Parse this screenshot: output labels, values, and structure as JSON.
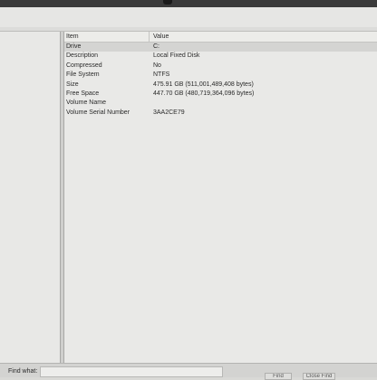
{
  "list": {
    "columns": {
      "item": "Item",
      "value": "Value"
    },
    "rows": [
      {
        "item": "Drive",
        "value": "C:"
      },
      {
        "item": "Description",
        "value": "Local Fixed Disk"
      },
      {
        "item": "Compressed",
        "value": "No"
      },
      {
        "item": "File System",
        "value": "NTFS"
      },
      {
        "item": "Size",
        "value": "475.91 GB (511,001,489,408 bytes)"
      },
      {
        "item": "Free Space",
        "value": "447.70 GB (480,719,364,096 bytes)"
      },
      {
        "item": "Volume Name",
        "value": ""
      },
      {
        "item": "Volume Serial Number",
        "value": "3AA2CE79"
      }
    ],
    "selected_row": "Drive"
  },
  "findbar": {
    "label": "Find what:",
    "input_value": "",
    "find_button": "Find",
    "close_button": "Close Find"
  }
}
